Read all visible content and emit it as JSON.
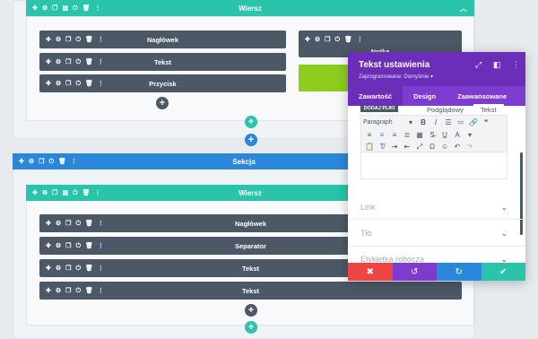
{
  "row1": {
    "label": "Wiersz",
    "toggle_icon": "chevron-up"
  },
  "row1_modules_left": [
    "Nagłówek",
    "Tekst",
    "Przycisk"
  ],
  "row1_right": {
    "module_label": "Notka"
  },
  "section": {
    "label": "Sekcja"
  },
  "row2": {
    "label": "Wiersz"
  },
  "row2_modules": [
    "Nagłówek",
    "Separator",
    "Tekst",
    "Tekst"
  ],
  "panel": {
    "title": "Tekst ustawienia",
    "preset": "Zaprogramowane: Domyślnie ▾",
    "tabs": [
      "Zawartość",
      "Design",
      "Zaawansowane"
    ],
    "add_media": "DODAJ PLIKI",
    "editor_tabs": [
      "Podglądowy",
      "Tekst"
    ],
    "format_select": "Paragraph",
    "accordion": [
      "Link",
      "Tło",
      "Etykietka robocza"
    ],
    "colors": {
      "header": "#6c2eb9",
      "tabs": "#7d3bd0",
      "cancel": "#ef4444",
      "undo": "#7d3bd0",
      "redo": "#2b87da",
      "save": "#29c4a9"
    }
  },
  "colors": {
    "row": "#29c4a9",
    "section": "#2b87da",
    "module": "#4c5866",
    "notka_fill": "#8fcc1e"
  }
}
